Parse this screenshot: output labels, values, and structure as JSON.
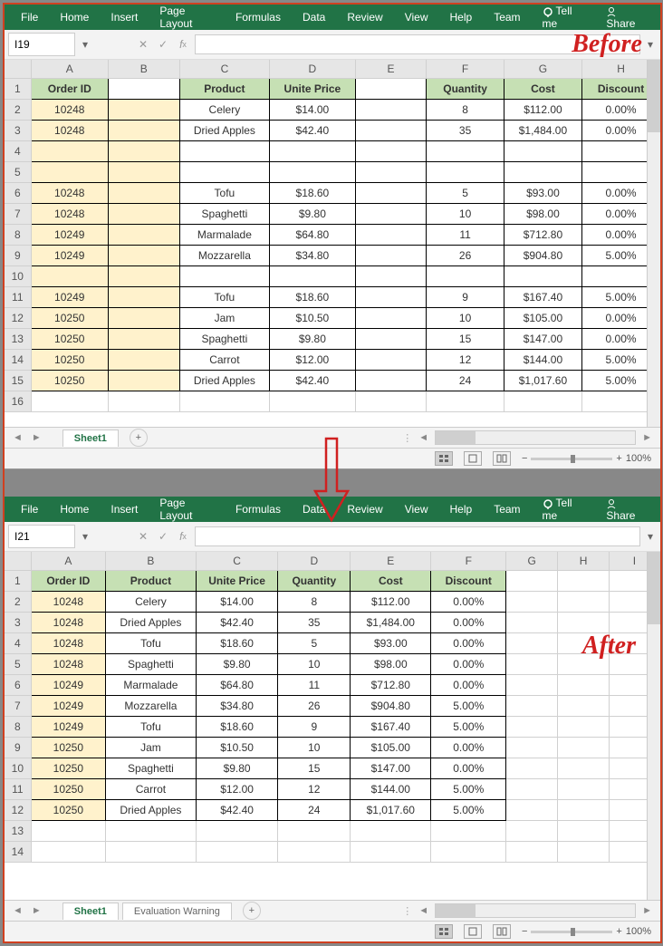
{
  "ribbon": {
    "items": [
      "File",
      "Home",
      "Insert",
      "Page Layout",
      "Formulas",
      "Data",
      "Review",
      "View",
      "Help",
      "Team"
    ],
    "tellme": "Tell me",
    "share": "Share"
  },
  "before": {
    "label": "Before",
    "namebox": "I19",
    "cols": [
      "A",
      "B",
      "C",
      "D",
      "E",
      "F",
      "G",
      "H"
    ],
    "headers": {
      "A": "Order ID",
      "C": "Product",
      "D": "Unite Price",
      "F": "Quantity",
      "G": "Cost",
      "H": "Discount"
    },
    "rows": [
      {
        "n": 1,
        "h": true
      },
      {
        "n": 2,
        "A": "10248",
        "C": "Celery",
        "D": "$14.00",
        "F": "8",
        "G": "$112.00",
        "H": "0.00%"
      },
      {
        "n": 3,
        "A": "10248",
        "C": "Dried Apples",
        "D": "$42.40",
        "F": "35",
        "G": "$1,484.00",
        "H": "0.00%"
      },
      {
        "n": 4,
        "blank": true
      },
      {
        "n": 5,
        "blank": true
      },
      {
        "n": 6,
        "A": "10248",
        "C": "Tofu",
        "D": "$18.60",
        "F": "5",
        "G": "$93.00",
        "H": "0.00%"
      },
      {
        "n": 7,
        "A": "10248",
        "C": "Spaghetti",
        "D": "$9.80",
        "F": "10",
        "G": "$98.00",
        "H": "0.00%"
      },
      {
        "n": 8,
        "A": "10249",
        "C": "Marmalade",
        "D": "$64.80",
        "F": "11",
        "G": "$712.80",
        "H": "0.00%"
      },
      {
        "n": 9,
        "A": "10249",
        "C": "Mozzarella",
        "D": "$34.80",
        "F": "26",
        "G": "$904.80",
        "H": "5.00%"
      },
      {
        "n": 10,
        "blank": true
      },
      {
        "n": 11,
        "A": "10249",
        "C": "Tofu",
        "D": "$18.60",
        "F": "9",
        "G": "$167.40",
        "H": "5.00%"
      },
      {
        "n": 12,
        "A": "10250",
        "C": "Jam",
        "D": "$10.50",
        "F": "10",
        "G": "$105.00",
        "H": "0.00%"
      },
      {
        "n": 13,
        "A": "10250",
        "C": "Spaghetti",
        "D": "$9.80",
        "F": "15",
        "G": "$147.00",
        "H": "0.00%"
      },
      {
        "n": 14,
        "A": "10250",
        "C": "Carrot",
        "D": "$12.00",
        "F": "12",
        "G": "$144.00",
        "H": "5.00%"
      },
      {
        "n": 15,
        "A": "10250",
        "C": "Dried Apples",
        "D": "$42.40",
        "F": "24",
        "G": "$1,017.60",
        "H": "5.00%"
      },
      {
        "n": 16,
        "plain": true
      }
    ],
    "sheets": [
      "Sheet1"
    ],
    "zoom": "100%"
  },
  "after": {
    "label": "After",
    "namebox": "I21",
    "cols": [
      "A",
      "B",
      "C",
      "D",
      "E",
      "F",
      "G",
      "H",
      "I"
    ],
    "headers": {
      "A": "Order ID",
      "B": "Product",
      "C": "Unite Price",
      "D": "Quantity",
      "E": "Cost",
      "F": "Discount"
    },
    "rows": [
      {
        "n": 1,
        "h": true
      },
      {
        "n": 2,
        "A": "10248",
        "B": "Celery",
        "C": "$14.00",
        "D": "8",
        "E": "$112.00",
        "F": "0.00%"
      },
      {
        "n": 3,
        "A": "10248",
        "B": "Dried Apples",
        "C": "$42.40",
        "D": "35",
        "E": "$1,484.00",
        "F": "0.00%"
      },
      {
        "n": 4,
        "A": "10248",
        "B": "Tofu",
        "C": "$18.60",
        "D": "5",
        "E": "$93.00",
        "F": "0.00%"
      },
      {
        "n": 5,
        "A": "10248",
        "B": "Spaghetti",
        "C": "$9.80",
        "D": "10",
        "E": "$98.00",
        "F": "0.00%"
      },
      {
        "n": 6,
        "A": "10249",
        "B": "Marmalade",
        "C": "$64.80",
        "D": "11",
        "E": "$712.80",
        "F": "0.00%"
      },
      {
        "n": 7,
        "A": "10249",
        "B": "Mozzarella",
        "C": "$34.80",
        "D": "26",
        "E": "$904.80",
        "F": "5.00%"
      },
      {
        "n": 8,
        "A": "10249",
        "B": "Tofu",
        "C": "$18.60",
        "D": "9",
        "E": "$167.40",
        "F": "5.00%"
      },
      {
        "n": 9,
        "A": "10250",
        "B": "Jam",
        "C": "$10.50",
        "D": "10",
        "E": "$105.00",
        "F": "0.00%"
      },
      {
        "n": 10,
        "A": "10250",
        "B": "Spaghetti",
        "C": "$9.80",
        "D": "15",
        "E": "$147.00",
        "F": "0.00%"
      },
      {
        "n": 11,
        "A": "10250",
        "B": "Carrot",
        "C": "$12.00",
        "D": "12",
        "E": "$144.00",
        "F": "5.00%"
      },
      {
        "n": 12,
        "A": "10250",
        "B": "Dried Apples",
        "C": "$42.40",
        "D": "24",
        "E": "$1,017.60",
        "F": "5.00%"
      },
      {
        "n": 13,
        "plain": true
      },
      {
        "n": 14,
        "plain": true
      }
    ],
    "sheets": [
      "Sheet1",
      "Evaluation Warning"
    ],
    "zoom": "100%"
  },
  "colw": {
    "before": {
      "A": 82,
      "B": 82,
      "C": 95,
      "D": 90,
      "E": 82,
      "F": 82,
      "G": 82,
      "H": 82
    },
    "after": {
      "A": 78,
      "B": 95,
      "C": 85,
      "D": 75,
      "E": 85,
      "F": 78,
      "G": 55,
      "H": 55,
      "I": 55
    }
  }
}
